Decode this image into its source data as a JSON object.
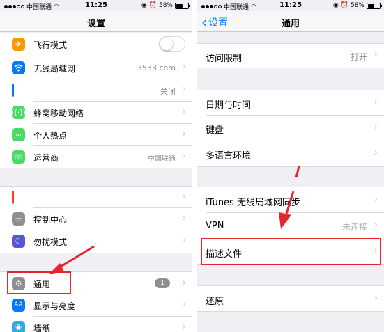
{
  "status": {
    "carrier": "中国联通",
    "time": "11:25",
    "battery": "58%",
    "battery_level": 0.58
  },
  "left": {
    "title": "设置",
    "items": {
      "airplane": {
        "label": "飞行模式",
        "toggle_on": false
      },
      "wifi": {
        "label": "无线局域网",
        "value": "3533.com"
      },
      "bluetooth": {
        "value": "关闭"
      },
      "cellular": {
        "label": "蜂窝移动网络"
      },
      "hotspot": {
        "label": "个人热点"
      },
      "carrier": {
        "label": "运营商",
        "value": "中国联通"
      },
      "control_center": {
        "label": "控制中心"
      },
      "dnd": {
        "label": "勿扰模式"
      },
      "general": {
        "label": "通用",
        "badge": "1"
      },
      "display": {
        "label": "显示与亮度",
        "icon_text": "AA"
      },
      "wallpaper": {
        "label": "墙纸"
      }
    }
  },
  "right": {
    "back_label": "设置",
    "title": "通用",
    "items": {
      "restrictions": {
        "label": "访问限制",
        "value": "打开"
      },
      "date_time": {
        "label": "日期与时间"
      },
      "keyboard": {
        "label": "键盘"
      },
      "language": {
        "label": "多语言环境"
      },
      "itunes_sync": {
        "label": "iTunes 无线局域网同步"
      },
      "vpn": {
        "label": "VPN",
        "value": "未连接"
      },
      "profile": {
        "label": "描述文件"
      },
      "reset": {
        "label": "还原"
      }
    }
  },
  "colors": {
    "ios_blue": "#007aff",
    "airplane": "#ff9500",
    "green": "#4cd964",
    "purple": "#5856d6",
    "gray": "#8e8e93",
    "annotation_red": "#e6262e"
  }
}
